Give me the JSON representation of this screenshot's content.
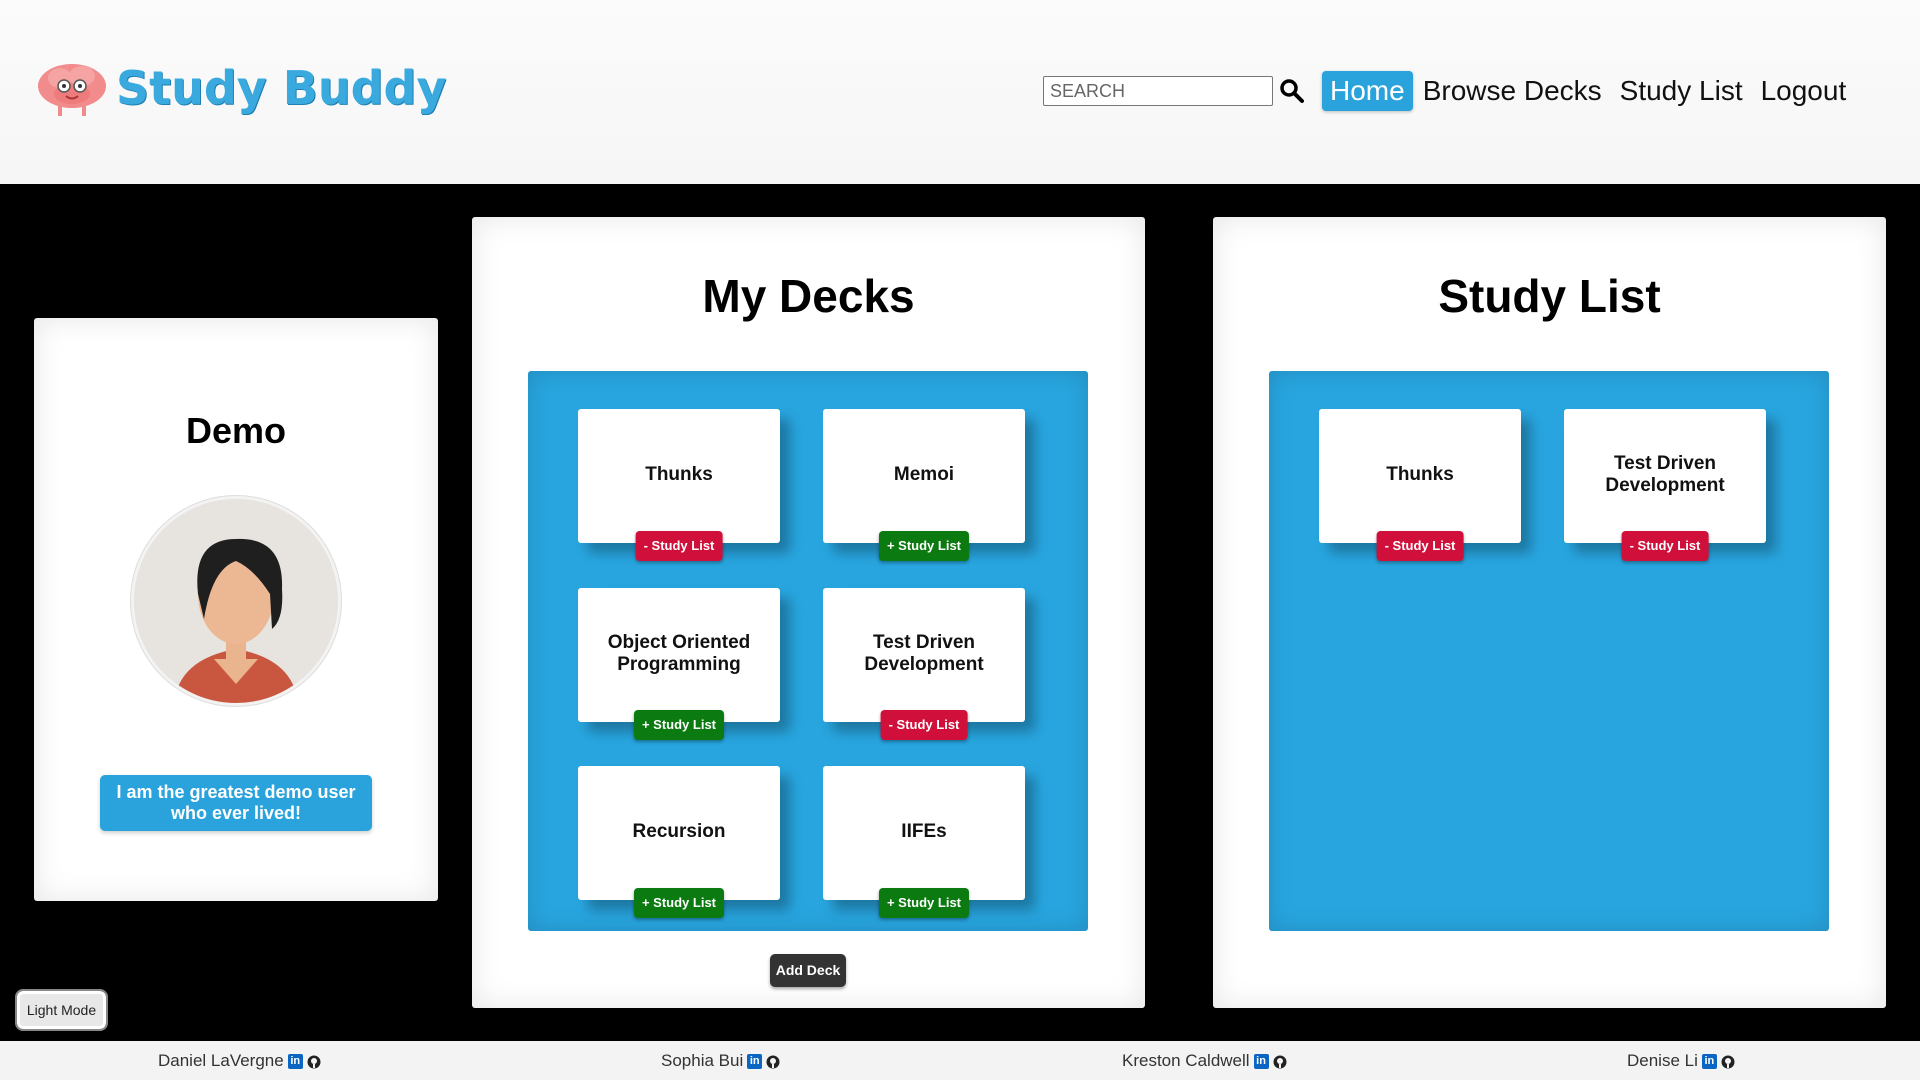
{
  "brand": {
    "name": "Study Buddy"
  },
  "search": {
    "placeholder": "SEARCH"
  },
  "nav": {
    "items": [
      "Home",
      "Browse Decks",
      "Study List",
      "Logout"
    ],
    "active": "Home"
  },
  "profile": {
    "name": "Demo",
    "bio": "I am the greatest demo user who ever lived!"
  },
  "my_decks": {
    "title": "My Decks",
    "cards": [
      {
        "title": "Thunks",
        "action": "- Study List"
      },
      {
        "title": "Memoi",
        "action": "+ Study List"
      },
      {
        "title": "Object Oriented Programming",
        "action": "+ Study List"
      },
      {
        "title": "Test Driven Development",
        "action": "- Study List"
      },
      {
        "title": "Recursion",
        "action": "+ Study List"
      },
      {
        "title": "IIFEs",
        "action": "+ Study List"
      }
    ],
    "add_button": "Add Deck"
  },
  "study_list": {
    "title": "Study List",
    "cards": [
      {
        "title": "Thunks",
        "action": "- Study List"
      },
      {
        "title": "Test Driven Development",
        "action": "- Study List"
      }
    ]
  },
  "theme_toggle": "Light Mode",
  "footer": {
    "credits": [
      "Daniel LaVergne",
      "Sophia Bui",
      "Kreston Caldwell",
      "Denise Li"
    ]
  },
  "colors": {
    "accent": "#2aa3dc",
    "remove": "#d0103a",
    "add": "#0b7a10",
    "background": "#000000"
  }
}
